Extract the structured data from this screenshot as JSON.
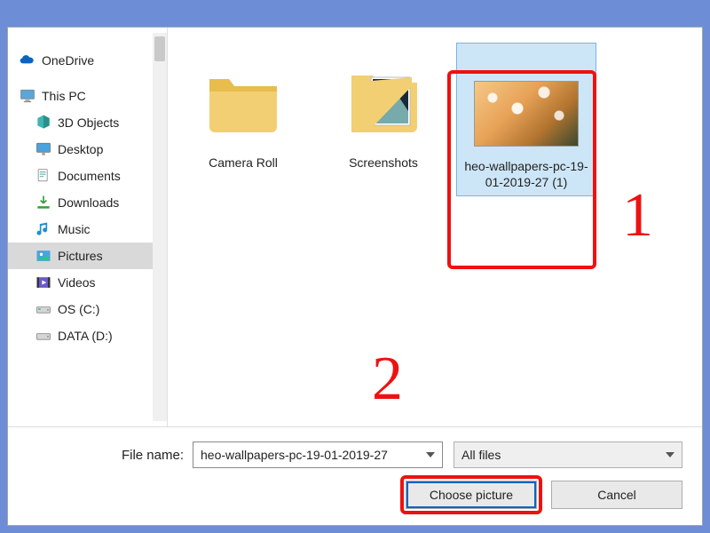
{
  "nav": {
    "onedrive": "OneDrive",
    "thispc": "This PC",
    "children": [
      "3D Objects",
      "Desktop",
      "Documents",
      "Downloads",
      "Music",
      "Pictures",
      "Videos",
      "OS (C:)",
      "DATA (D:)"
    ],
    "selected_index": 5
  },
  "files": [
    {
      "type": "folder",
      "label": "Camera Roll"
    },
    {
      "type": "folder-ss",
      "label": "Screenshots"
    },
    {
      "type": "image",
      "label": "heo-wallpapers-pc-19-01-2019-27 (1)",
      "selected": true
    }
  ],
  "footer": {
    "filename_label": "File name:",
    "filename_value": "heo-wallpapers-pc-19-01-2019-27",
    "filter_value": "All files",
    "choose_label": "Choose picture",
    "cancel_label": "Cancel"
  },
  "annotations": {
    "one": "1",
    "two": "2"
  }
}
